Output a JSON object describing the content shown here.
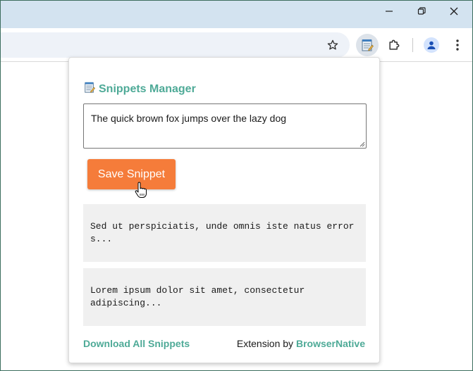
{
  "window": {
    "minimize_icon": "minimize-icon",
    "restore_icon": "restore-icon",
    "close_icon": "close-icon"
  },
  "toolbar": {
    "bookmark_icon": "star-icon",
    "active_extension_icon": "notepad-icon",
    "extensions_icon": "puzzle-icon",
    "profile_icon": "person-icon",
    "menu_icon": "kebab-menu-icon"
  },
  "popup": {
    "title": "Snippets Manager",
    "title_icon": "notepad-icon",
    "input_value": "The quick brown fox jumps over the lazy dog",
    "save_label": "Save Snippet",
    "snippets": [
      "Sed ut perspiciatis, unde omnis iste natus error\ns...",
      "Lorem ipsum dolor sit amet, consectetur\nadipiscing..."
    ],
    "download_label": "Download All Snippets",
    "credit_prefix": "Extension by",
    "credit_brand": "BrowserNative"
  },
  "colors": {
    "accent": "#4eaa97",
    "button": "#f57c3a",
    "card_bg": "#f0f0f0",
    "titlebar": "#d3e3f0"
  }
}
